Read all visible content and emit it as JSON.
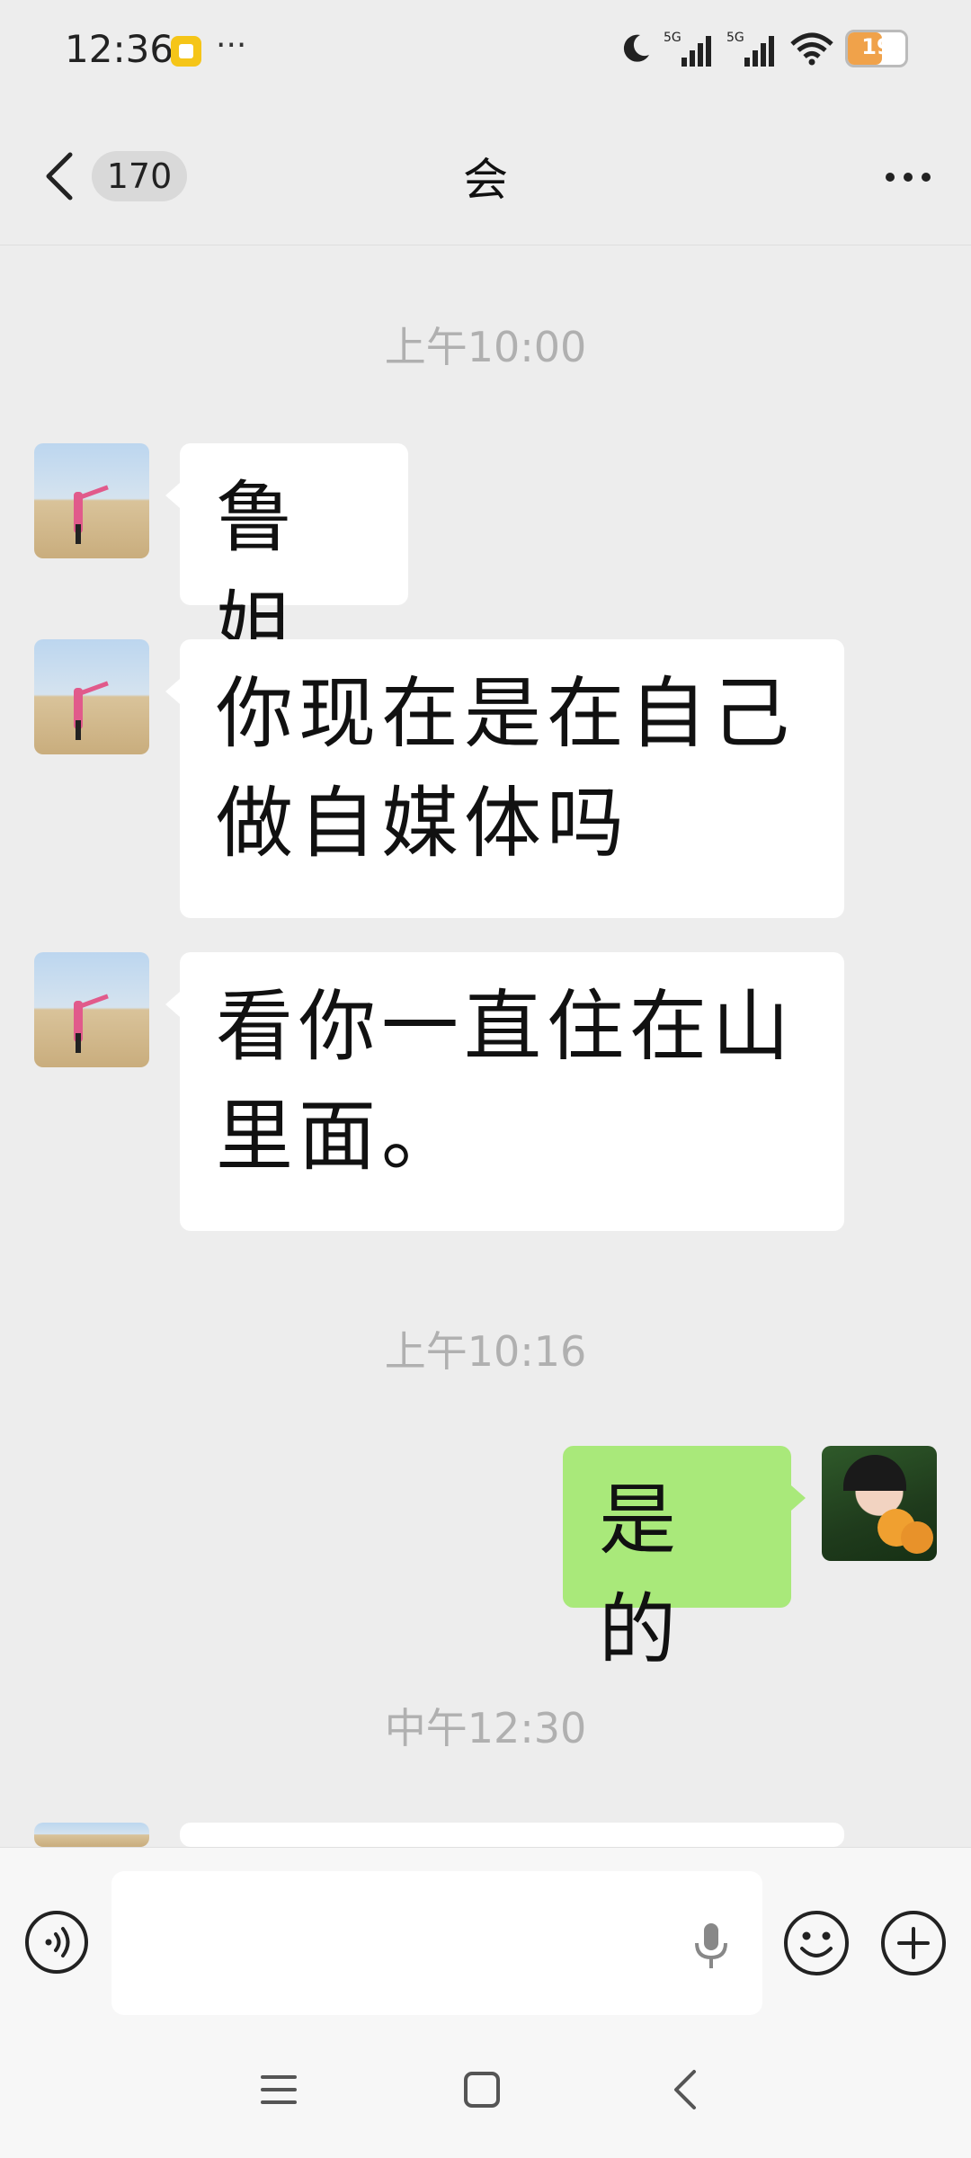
{
  "status_bar": {
    "time": "12:36",
    "dots": "···",
    "network_1": "5G",
    "network_2": "5G",
    "battery_level": "19",
    "battery_color": "#f0a24a"
  },
  "header": {
    "unread_count": "170",
    "title": "会",
    "back_icon": "chevron-left-icon",
    "more_icon": "more-dots-icon"
  },
  "messages": [
    {
      "type": "timestamp",
      "text": "上午10:00"
    },
    {
      "type": "message",
      "side": "left",
      "text": "鲁姐"
    },
    {
      "type": "message",
      "side": "left",
      "text": "你现在是在自己做自媒体吗"
    },
    {
      "type": "message",
      "side": "left",
      "text": "看你一直住在山里面。"
    },
    {
      "type": "timestamp",
      "text": "上午10:16"
    },
    {
      "type": "message",
      "side": "right",
      "text": "是的"
    },
    {
      "type": "timestamp",
      "text": "中午12:30"
    }
  ],
  "input_bar": {
    "placeholder": "",
    "voice_icon": "voice-icon",
    "mic_icon": "mic-icon",
    "emoji_icon": "emoji-icon",
    "plus_icon": "plus-icon"
  },
  "colors": {
    "background": "#ededed",
    "self_bubble": "#a9e97a",
    "other_bubble": "#ffffff"
  }
}
